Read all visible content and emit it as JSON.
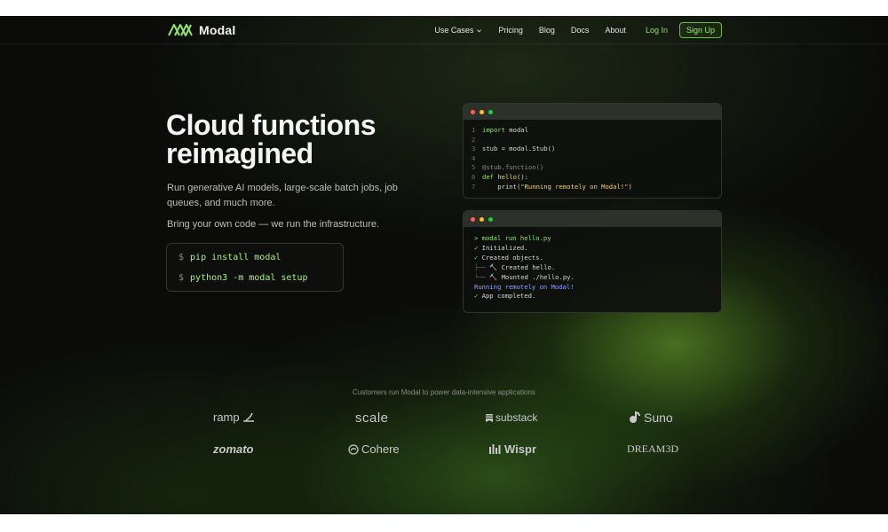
{
  "brand": {
    "name": "Modal"
  },
  "nav": {
    "use_cases": "Use Cases",
    "pricing": "Pricing",
    "blog": "Blog",
    "docs": "Docs",
    "about": "About",
    "login": "Log In",
    "signup": "Sign Up"
  },
  "hero": {
    "title_line1": "Cloud functions",
    "title_line2": "reimagined",
    "subtitle": "Run generative AI models, large-scale batch jobs, job queues, and much more.",
    "subtitle2": "Bring your own code — we run the infrastructure.",
    "prompt": "$",
    "commands": [
      "pip install modal",
      "python3 -m modal setup"
    ]
  },
  "code_window": {
    "lines": [
      {
        "n": "1",
        "parts": [
          [
            "kw",
            "import"
          ],
          [
            "txt",
            " modal"
          ]
        ]
      },
      {
        "n": "2",
        "parts": []
      },
      {
        "n": "3",
        "parts": [
          [
            "txt",
            "stub = modal.Stub()"
          ]
        ]
      },
      {
        "n": "4",
        "parts": []
      },
      {
        "n": "5",
        "parts": [
          [
            "dec",
            "@stub.function()"
          ]
        ]
      },
      {
        "n": "6",
        "parts": [
          [
            "kw",
            "def"
          ],
          [
            "txt",
            " "
          ],
          [
            "fn",
            "hello"
          ],
          [
            "txt",
            "():"
          ]
        ]
      },
      {
        "n": "7",
        "parts": [
          [
            "txt",
            "    print("
          ],
          [
            "str",
            "\"Running remotely on Modal!\""
          ],
          [
            "txt",
            ")"
          ]
        ]
      }
    ]
  },
  "terminal_window": {
    "lines": [
      [
        [
          "t-green",
          "> modal run hello.py"
        ]
      ],
      [
        [
          "t-green",
          "✓ "
        ],
        [
          "txt",
          "Initialized."
        ]
      ],
      [
        [
          "t-green",
          "✓ "
        ],
        [
          "txt",
          "Created objects."
        ]
      ],
      [
        [
          "t-dim",
          "├── "
        ],
        [
          "txt",
          "🔨 Created hello."
        ]
      ],
      [
        [
          "t-dim",
          "└── "
        ],
        [
          "txt",
          "🔨 Mounted ./hello.py."
        ]
      ],
      [
        [
          "t-blue",
          "Running remotely on Modal!"
        ]
      ],
      [
        [
          "t-green",
          "✓ "
        ],
        [
          "txt",
          "App completed."
        ]
      ]
    ]
  },
  "customers": {
    "caption": "Customers run Modal to power data-intensive applications",
    "logos": [
      "ramp",
      "scale",
      "substack",
      "Suno",
      "zomato",
      "Cohere",
      "Wispr",
      "DREAM3D"
    ]
  },
  "colors": {
    "accent": "#8fe56a",
    "background": "#0b0c0a"
  }
}
